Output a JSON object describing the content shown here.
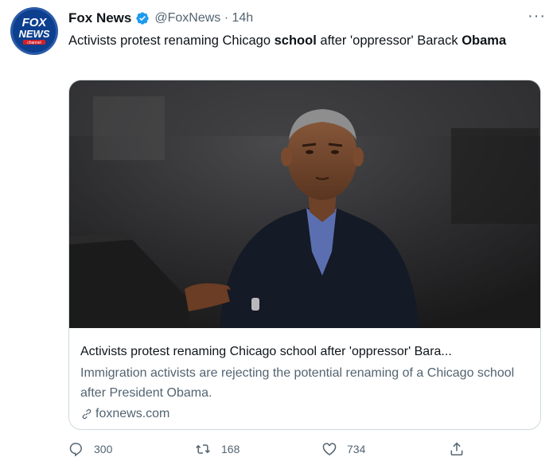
{
  "tweet": {
    "display_name": "Fox News",
    "verified": true,
    "handle_time": "@FoxNews · 14h",
    "more_icon": "more-horizontal-icon",
    "text_parts": {
      "p1": "Activists protest renaming Chicago ",
      "p2": "school",
      "p3": " after 'oppressor' Barack ",
      "p4": "Obama"
    }
  },
  "avatar": {
    "logo_line1": "FOX",
    "logo_line2": "NEWS",
    "logo_line3": "channel",
    "colors": {
      "ring": "#2a5ba8",
      "fill": "#0d3f8f",
      "red": "#d0202a"
    }
  },
  "card": {
    "title": "Activists protest renaming Chicago school after 'oppressor' Bara...",
    "description": "Immigration activists are rejecting the potential renaming of a Chicago school after President Obama.",
    "domain": "foxnews.com",
    "link_icon": "link-icon"
  },
  "actions": {
    "reply": {
      "icon": "reply-icon",
      "count": "300"
    },
    "retweet": {
      "icon": "retweet-icon",
      "count": "168"
    },
    "like": {
      "icon": "heart-icon",
      "count": "734"
    },
    "share": {
      "icon": "share-icon"
    }
  },
  "colors": {
    "verified": "#1d9bf0",
    "text": "#0f1419",
    "secondary": "#536471",
    "border": "#cfd9de"
  }
}
